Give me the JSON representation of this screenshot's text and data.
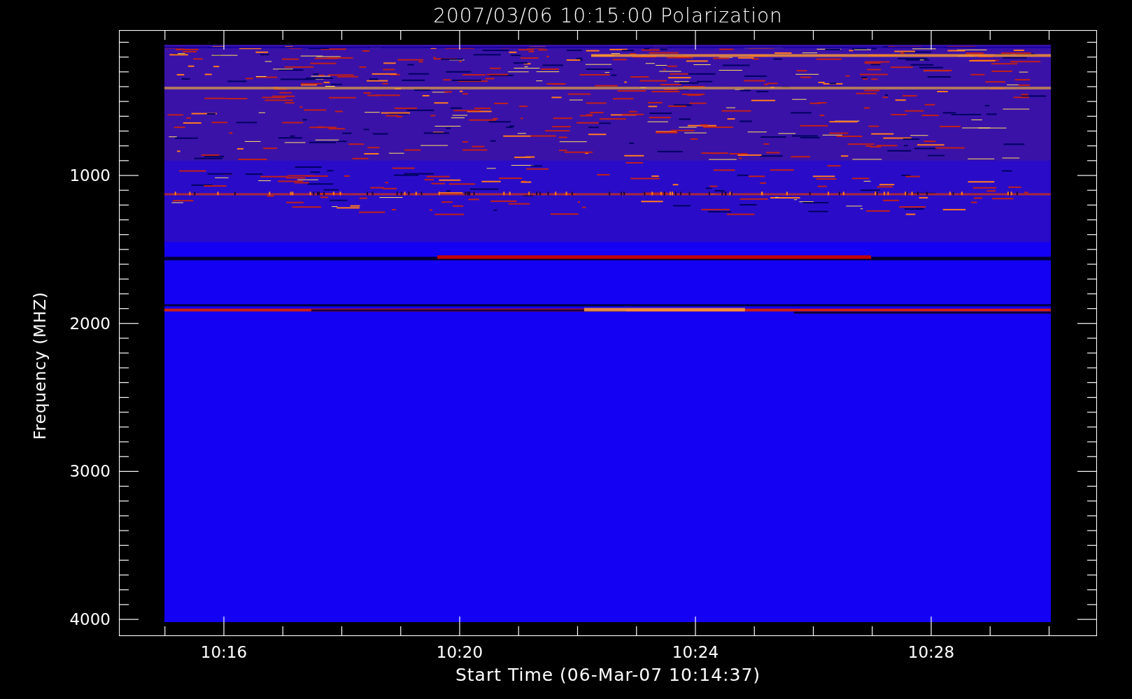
{
  "title": "2007/03/06 10:15:00 Polarization",
  "y_axis": {
    "label": "Frequency (MHZ)",
    "ticks": [
      "1000",
      "2000",
      "3000",
      "4000"
    ]
  },
  "x_axis": {
    "label": "Start Time (06-Mar-07 10:14:37)",
    "ticks": [
      "10:16",
      "10:20",
      "10:24",
      "10:28"
    ]
  }
}
